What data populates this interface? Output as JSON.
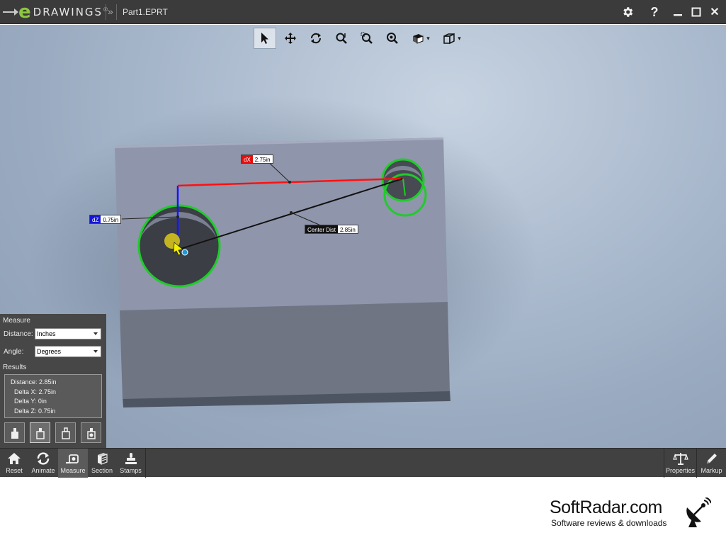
{
  "titlebar": {
    "logo_letter": "e",
    "logo_word": "DRAWINGS",
    "logo_reg": "®",
    "chevron": "»",
    "filename": "Part1.EPRT",
    "gear_icon": "gear-icon",
    "help_label": "?",
    "minimize_icon": "minimize-icon",
    "maximize_icon": "maximize-icon",
    "close_label": "✕"
  },
  "view_toolbar": {
    "tools": [
      "select-icon",
      "pan-icon",
      "rotate-icon",
      "zoom-to-fit-icon",
      "zoom-to-area-icon",
      "zoom-icon",
      "view-style-icon",
      "view-orientation-icon"
    ],
    "caret": "▾"
  },
  "dimensions": {
    "dx": {
      "key": "dX",
      "value": "2.75in",
      "color": "#e01010"
    },
    "dz": {
      "key": "dZ",
      "value": "0.75in",
      "color": "#1515d0"
    },
    "center_dist": {
      "key": "Center Dist",
      "value": "2.85in",
      "color": "#111111"
    }
  },
  "measure_panel": {
    "title": "Measure",
    "distance_label": "Distance:",
    "distance_value": "Inches",
    "angle_label": "Angle:",
    "angle_value": "Degrees",
    "results_title": "Results",
    "results": {
      "distance": "Distance: 2.85in",
      "delta_x": "Delta X: 2.75in",
      "delta_y": "Delta Y: 0in",
      "delta_z": "Delta Z: 0.75in"
    }
  },
  "bottom_bar": {
    "reset": "Reset",
    "animate": "Animate",
    "measure": "Measure",
    "section": "Section",
    "stamps": "Stamps",
    "properties": "Properties",
    "markup": "Markup"
  },
  "watermark": {
    "name": "SoftRadar.com",
    "tagline": "Software reviews & downloads"
  },
  "colors": {
    "titlebar": "#3b3b3b",
    "logo_green": "#8dc63f",
    "panel": "#474747",
    "selection_green": "#1fcc2a"
  }
}
